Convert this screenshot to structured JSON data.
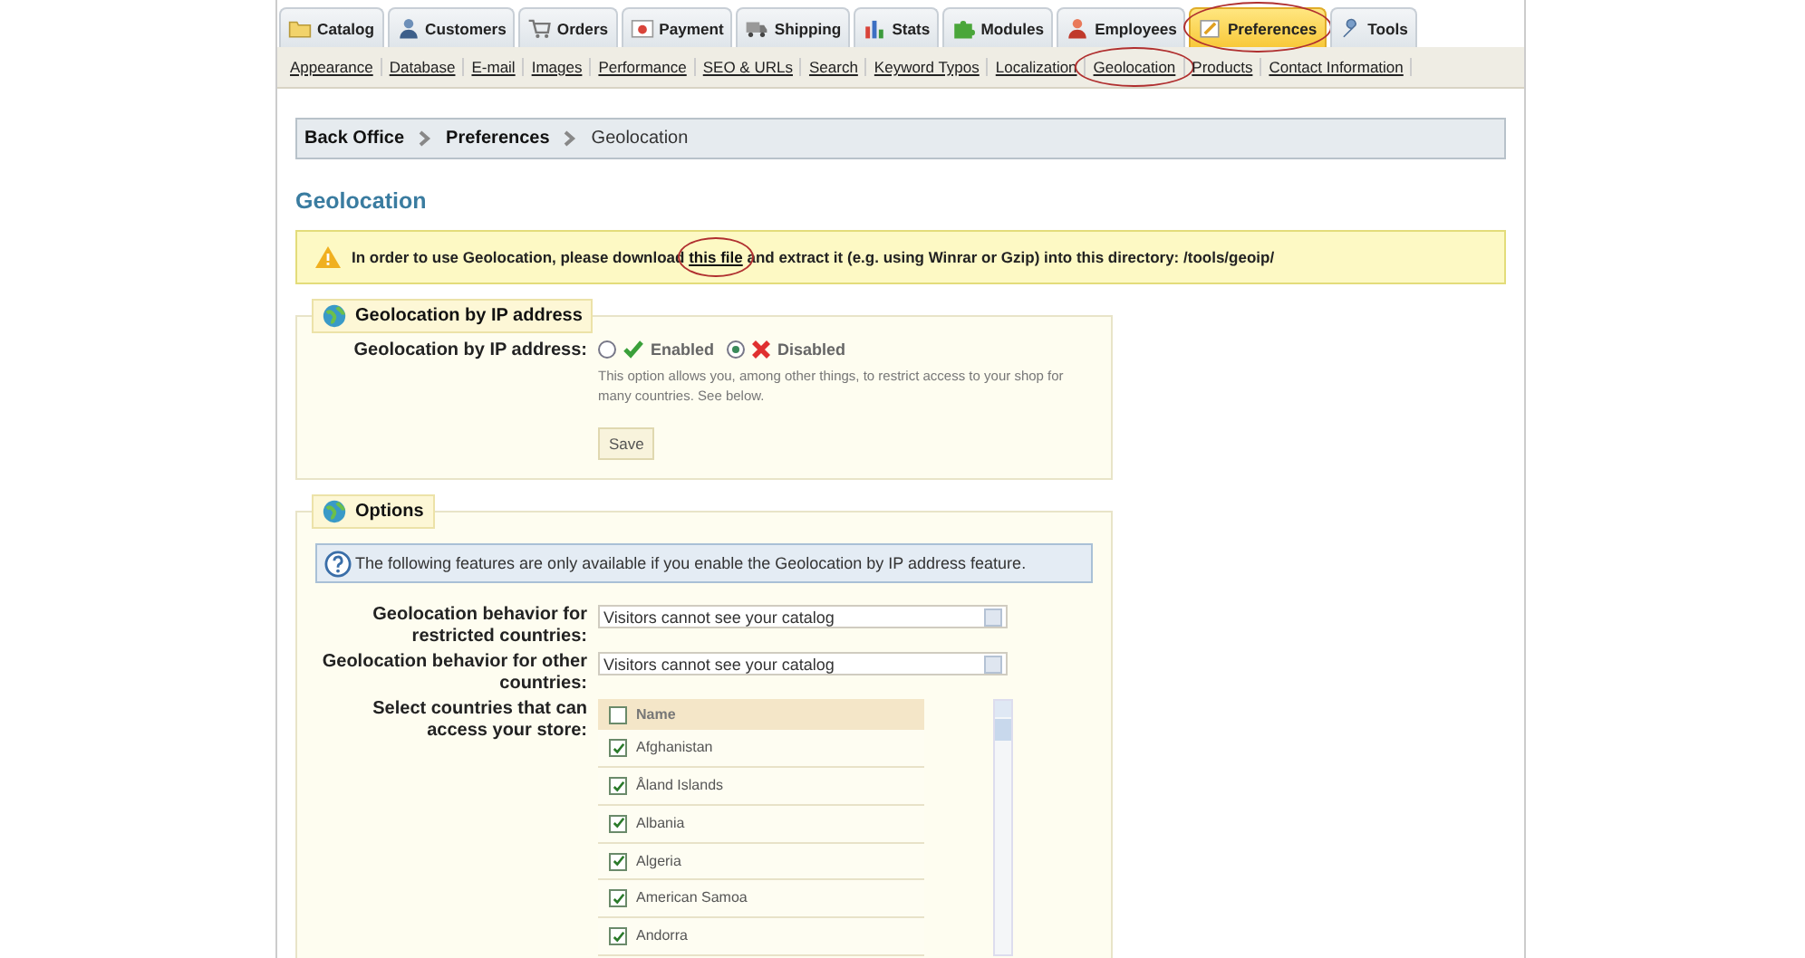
{
  "tabs": [
    {
      "label": "Catalog",
      "selected": false
    },
    {
      "label": "Customers",
      "selected": false
    },
    {
      "label": "Orders",
      "selected": false
    },
    {
      "label": "Payment",
      "selected": false
    },
    {
      "label": "Shipping",
      "selected": false
    },
    {
      "label": "Stats",
      "selected": false
    },
    {
      "label": "Modules",
      "selected": false
    },
    {
      "label": "Employees",
      "selected": false
    },
    {
      "label": "Preferences",
      "selected": true,
      "circled": true
    },
    {
      "label": "Tools",
      "selected": false
    }
  ],
  "subnav": [
    {
      "label": "Appearance"
    },
    {
      "label": "Database"
    },
    {
      "label": "E-mail"
    },
    {
      "label": "Images"
    },
    {
      "label": "Performance"
    },
    {
      "label": "SEO & URLs"
    },
    {
      "label": "Search"
    },
    {
      "label": "Keyword Typos"
    },
    {
      "label": "Localization"
    },
    {
      "label": "Geolocation",
      "circled": true
    },
    {
      "label": "Products"
    },
    {
      "label": "Contact Information"
    }
  ],
  "breadcrumb": [
    "Back Office",
    "Preferences",
    "Geolocation"
  ],
  "page_title": "Geolocation",
  "warning": {
    "before": "In order to use Geolocation, please download ",
    "link": "this file",
    "link_circled": true,
    "after": " and extract it (e.g. using Winrar or Gzip) into this directory: /tools/geoip/"
  },
  "ip_section": {
    "legend": "Geolocation by IP address",
    "label": "Geolocation by IP address:",
    "options": [
      {
        "label": "Enabled",
        "kind": "yes",
        "selected": false
      },
      {
        "label": "Disabled",
        "kind": "no",
        "selected": true
      }
    ],
    "hint": "This option allows you, among other things, to restrict access to your shop for many countries. See below.",
    "save": "Save"
  },
  "options_section": {
    "legend": "Options",
    "info": "The following features are only available if you enable the Geolocation by IP address feature.",
    "selects": [
      {
        "label": "Geolocation behavior for restricted countries:",
        "value": "Visitors cannot see your catalog"
      },
      {
        "label": "Geolocation behavior for other countries:",
        "value": "Visitors cannot see your catalog"
      }
    ],
    "countries_label": "Select countries that can access your store:",
    "countries_header": {
      "label": "Name",
      "checked": false
    },
    "countries": [
      {
        "name": "Afghanistan",
        "checked": true
      },
      {
        "name": "Åland Islands",
        "checked": true
      },
      {
        "name": "Albania",
        "checked": true
      },
      {
        "name": "Algeria",
        "checked": true
      },
      {
        "name": "American Samoa",
        "checked": true
      },
      {
        "name": "Andorra",
        "checked": true
      }
    ]
  }
}
